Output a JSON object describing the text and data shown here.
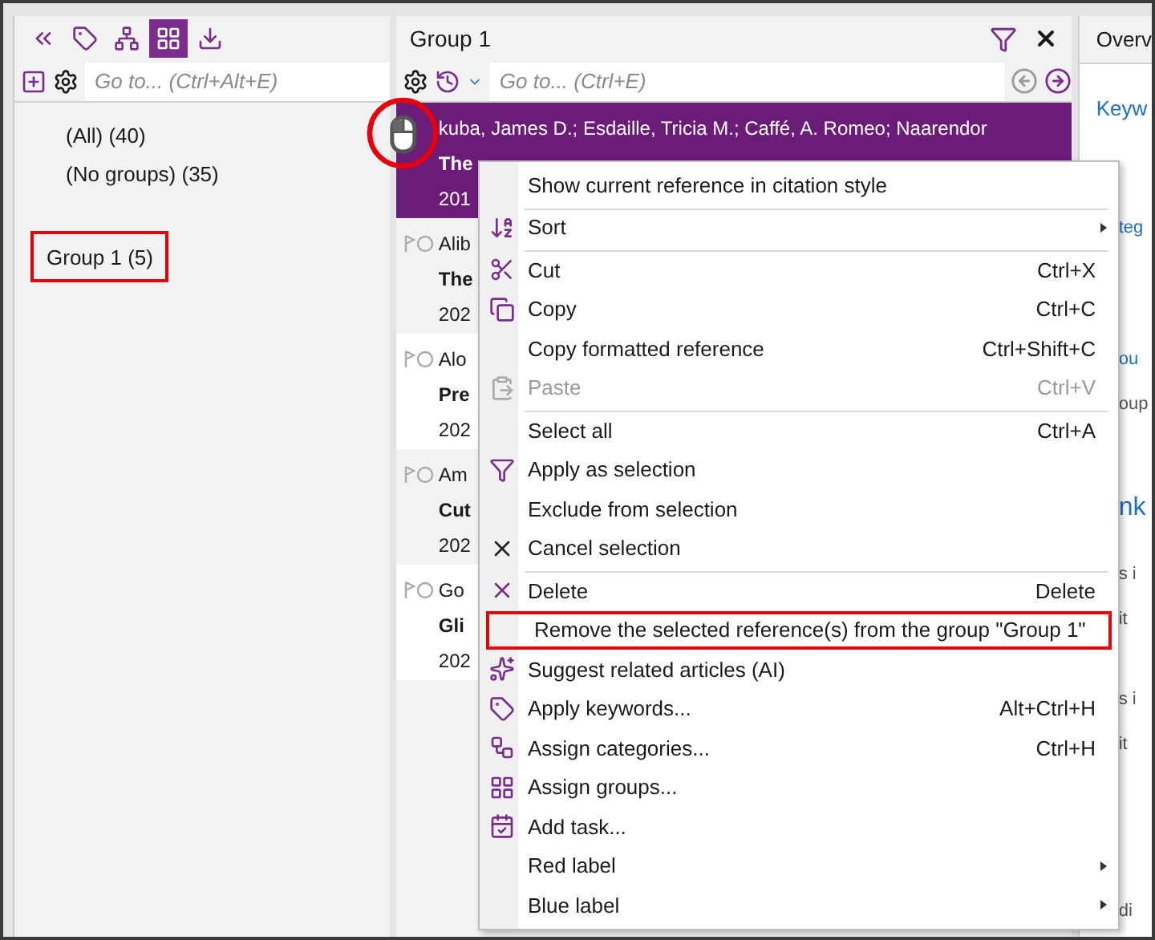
{
  "left_panel": {
    "toolbar": [
      {
        "selected": false
      },
      {
        "selected": false
      },
      {
        "selected": false
      },
      {
        "selected": true
      },
      {
        "selected": false
      }
    ],
    "search": {
      "placeholder": "Go to... (Ctrl+Alt+E)"
    },
    "groups": [
      {
        "label": "(All) (40)",
        "marked": false
      },
      {
        "label": "(No groups) (35)",
        "marked": false
      },
      {
        "label": "Group 1 (5)",
        "marked": true
      }
    ]
  },
  "reference_panel": {
    "title": "Group 1",
    "search": {
      "placeholder": "Go to... (Ctrl+E)"
    },
    "references": [
      {
        "authors": "kuba, James D.; Esdaille, Tricia M.; Caffé, A. Romeo; Naarendor",
        "title": "The",
        "year": "201",
        "selected": true
      },
      {
        "authors": "Alib",
        "title": "The",
        "year": "202",
        "selected": false
      },
      {
        "authors": "Alo",
        "title": "Pre",
        "year": "202",
        "selected": false
      },
      {
        "authors": "Am",
        "title": "Cut",
        "year": "202",
        "selected": false
      },
      {
        "authors": "Go",
        "title": "Gli",
        "year": "202",
        "selected": false
      }
    ]
  },
  "right_panel": {
    "tab": "Overv",
    "fragments": [
      {
        "text": "Keyw",
        "kind": "link"
      },
      {
        "text": "teg",
        "kind": "link"
      },
      {
        "text": "ou",
        "kind": "link"
      },
      {
        "text": "oup",
        "kind": "text"
      },
      {
        "text": "nk",
        "kind": "heading"
      },
      {
        "text": "s i",
        "kind": "text"
      },
      {
        "text": "it",
        "kind": "text"
      },
      {
        "text": "s i",
        "kind": "text"
      },
      {
        "text": "it",
        "kind": "text"
      },
      {
        "text": "di",
        "kind": "text"
      }
    ]
  },
  "context_menu": [
    {
      "label": "Show current reference in citation style",
      "disabled": false,
      "separator_before": false,
      "submenu": false,
      "marked": false
    },
    {
      "label": "Sort",
      "disabled": false,
      "separator_before": true,
      "submenu": true,
      "marked": false
    },
    {
      "label": "Cut",
      "shortcut": "Ctrl+X",
      "disabled": false,
      "separator_before": true,
      "submenu": false,
      "marked": false
    },
    {
      "label": "Copy",
      "shortcut": "Ctrl+C",
      "disabled": false,
      "separator_before": false,
      "submenu": false,
      "marked": false
    },
    {
      "label": "Copy formatted reference",
      "shortcut": "Ctrl+Shift+C",
      "disabled": false,
      "separator_before": false,
      "submenu": false,
      "marked": false
    },
    {
      "label": "Paste",
      "shortcut": "Ctrl+V",
      "disabled": true,
      "separator_before": false,
      "submenu": false,
      "marked": false
    },
    {
      "label": "Select all",
      "shortcut": "Ctrl+A",
      "disabled": false,
      "separator_before": true,
      "submenu": false,
      "marked": false
    },
    {
      "label": "Apply as selection",
      "disabled": false,
      "separator_before": false,
      "submenu": false,
      "marked": false
    },
    {
      "label": "Exclude from selection",
      "disabled": false,
      "separator_before": false,
      "submenu": false,
      "marked": false
    },
    {
      "label": "Cancel selection",
      "disabled": false,
      "separator_before": false,
      "submenu": false,
      "marked": false
    },
    {
      "label": "Delete",
      "shortcut": "Delete",
      "disabled": false,
      "separator_before": true,
      "submenu": false,
      "marked": false
    },
    {
      "label": "Remove the selected reference(s) from the group \"Group 1\"",
      "disabled": false,
      "separator_before": false,
      "submenu": false,
      "marked": true
    },
    {
      "label": "Suggest related articles (AI)",
      "disabled": false,
      "separator_before": false,
      "submenu": false,
      "marked": false
    },
    {
      "label": "Apply keywords...",
      "shortcut": "Alt+Ctrl+H",
      "disabled": false,
      "separator_before": false,
      "submenu": false,
      "marked": false
    },
    {
      "label": "Assign categories...",
      "shortcut": "Ctrl+H",
      "disabled": false,
      "separator_before": false,
      "submenu": false,
      "marked": false
    },
    {
      "label": "Assign groups...",
      "disabled": false,
      "separator_before": false,
      "submenu": false,
      "marked": false
    },
    {
      "label": "Add task...",
      "disabled": false,
      "separator_before": false,
      "submenu": false,
      "marked": false
    },
    {
      "label": "Red label",
      "disabled": false,
      "separator_before": false,
      "submenu": true,
      "marked": false
    },
    {
      "label": "Blue label",
      "disabled": false,
      "separator_before": false,
      "submenu": true,
      "marked": false
    }
  ]
}
